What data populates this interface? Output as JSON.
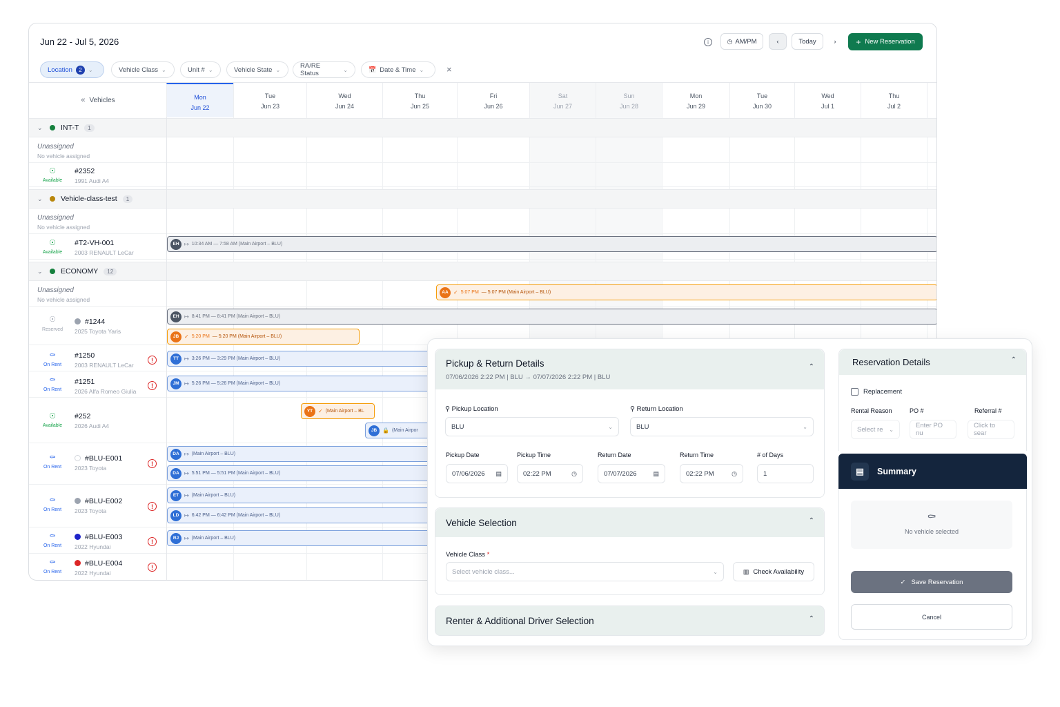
{
  "header": {
    "date_range": "Jun 22 - Jul 5, 2026",
    "ampm_label": "AM/PM",
    "today_label": "Today",
    "new_reservation_label": "New Reservation"
  },
  "filters": {
    "location": {
      "label": "Location",
      "count": "2"
    },
    "vehicle_class": "Vehicle Class",
    "unit": "Unit #",
    "vehicle_state": "Vehicle State",
    "rare_status": "RA/RE Status",
    "date_time": "Date & Time",
    "clear": "×"
  },
  "vehicles_header": "Vehicles",
  "days": [
    {
      "dow": "Mon",
      "date": "Jun 22"
    },
    {
      "dow": "Tue",
      "date": "Jun 23"
    },
    {
      "dow": "Wed",
      "date": "Jun 24"
    },
    {
      "dow": "Thu",
      "date": "Jun 25"
    },
    {
      "dow": "Fri",
      "date": "Jun 26"
    },
    {
      "dow": "Sat",
      "date": "Jun 27"
    },
    {
      "dow": "Sun",
      "date": "Jun 28"
    },
    {
      "dow": "Mon",
      "date": "Jun 29"
    },
    {
      "dow": "Tue",
      "date": "Jun 30"
    },
    {
      "dow": "Wed",
      "date": "Jul 1"
    },
    {
      "dow": "Thu",
      "date": "Jul 2"
    }
  ],
  "groups": [
    {
      "name": "INT-T",
      "count": "1",
      "color": "#15803d"
    },
    {
      "name": "Vehicle-class-test",
      "count": "1",
      "color": "#b8860b"
    },
    {
      "name": "ECONOMY",
      "count": "12",
      "color": "#15803d"
    }
  ],
  "unassigned": {
    "title": "Unassigned",
    "subtitle": "No vehicle assigned"
  },
  "vehicles": [
    {
      "id": "#2352",
      "model": "1991 Audi A4",
      "status": "Available"
    },
    {
      "id": "#T2-VH-001",
      "model": "2003 RENAULT LeCar",
      "status": "Available"
    },
    {
      "id": "#1244",
      "model": "2025 Toyota Yaris",
      "status": "Reserved"
    },
    {
      "id": "#1250",
      "model": "2003 RENAULT LeCar",
      "status": "On Rent"
    },
    {
      "id": "#1251",
      "model": "2026 Alfa Romeo Giulia",
      "status": "On Rent"
    },
    {
      "id": "#252",
      "model": "2026 Audi A4",
      "status": "Available"
    },
    {
      "id": "#BLU-E001",
      "model": "2023 Toyota",
      "status": "On Rent"
    },
    {
      "id": "#BLU-E002",
      "model": "2023 Toyota",
      "status": "On Rent"
    },
    {
      "id": "#BLU-E003",
      "model": "2022 Hyundai",
      "status": "On Rent"
    },
    {
      "id": "#BLU-E004",
      "model": "2022 Hyundai",
      "status": "On Rent"
    }
  ],
  "bookings": {
    "eh1": {
      "initials": "EH",
      "text": "10:34 AM — 7:58 AM (Main Airport – BLU)"
    },
    "aa": {
      "initials": "AA",
      "time": "5:07 PM",
      "text": "— 5:07 PM (Main Airport – BLU)"
    },
    "eh2": {
      "initials": "EH",
      "text": "8:41 PM — 8:41 PM (Main Airport – BLU)"
    },
    "jb1": {
      "initials": "JB",
      "time": "5:20 PM",
      "text": "— 5:20 PM (Main Airport – BLU)"
    },
    "tt": {
      "initials": "TT",
      "text": "3:26 PM — 3:29 PM (Main Airport – BLU)"
    },
    "jm": {
      "initials": "JM",
      "text": "5:26 PM — 5:26 PM (Main Airport – BLU)"
    },
    "yt": {
      "initials": "YT",
      "text": "(Main Airport – BL"
    },
    "jb2": {
      "initials": "JB",
      "text": "(Main Airpor"
    },
    "da1": {
      "initials": "DA",
      "text": "(Main Airport – BLU)"
    },
    "da2": {
      "initials": "DA",
      "text": "5:51 PM — 5:51 PM (Main Airport – BLU)"
    },
    "et": {
      "initials": "ET",
      "text": "(Main Airport – BLU)"
    },
    "ld": {
      "initials": "LD",
      "text": "6:42 PM — 6:42 PM (Main Airport – BLU)"
    },
    "rj": {
      "initials": "RJ",
      "text": "(Main Airport – BLU)"
    }
  },
  "modal": {
    "pickup_return": {
      "title": "Pickup & Return Details",
      "summary": "07/06/2026 2:22 PM | BLU → 07/07/2026 2:22 PM | BLU",
      "pickup_location_label": "Pickup Location",
      "pickup_location_value": "BLU",
      "return_location_label": "Return Location",
      "return_location_value": "BLU",
      "pickup_date_label": "Pickup Date",
      "pickup_date_value": "07/06/2026",
      "pickup_time_label": "Pickup Time",
      "pickup_time_value": "02:22  PM",
      "return_date_label": "Return Date",
      "return_date_value": "07/07/2026",
      "return_time_label": "Return Time",
      "return_time_value": "02:22  PM",
      "days_label": "# of Days",
      "days_value": "1"
    },
    "vehicle_selection": {
      "title": "Vehicle Selection",
      "class_label": "Vehicle Class",
      "required_mark": "*",
      "class_placeholder": "Select vehicle class...",
      "check_label": "Check Availability"
    },
    "renter": {
      "title": "Renter & Additional Driver Selection"
    },
    "reservation_details": {
      "title": "Reservation Details",
      "replacement_label": "Replacement",
      "rental_reason_label": "Rental Reason",
      "rental_reason_placeholder": "Select re",
      "po_label": "PO #",
      "po_placeholder": "Enter PO nu",
      "referral_label": "Referral #",
      "referral_placeholder": "Click to sear"
    },
    "summary": {
      "title": "Summary",
      "no_vehicle": "No vehicle selected",
      "save_label": "Save Reservation",
      "cancel_label": "Cancel"
    }
  },
  "colors": {
    "brand_green": "#0f7a4f",
    "summary_navy": "#14253d",
    "today_blue": "#2563eb"
  }
}
